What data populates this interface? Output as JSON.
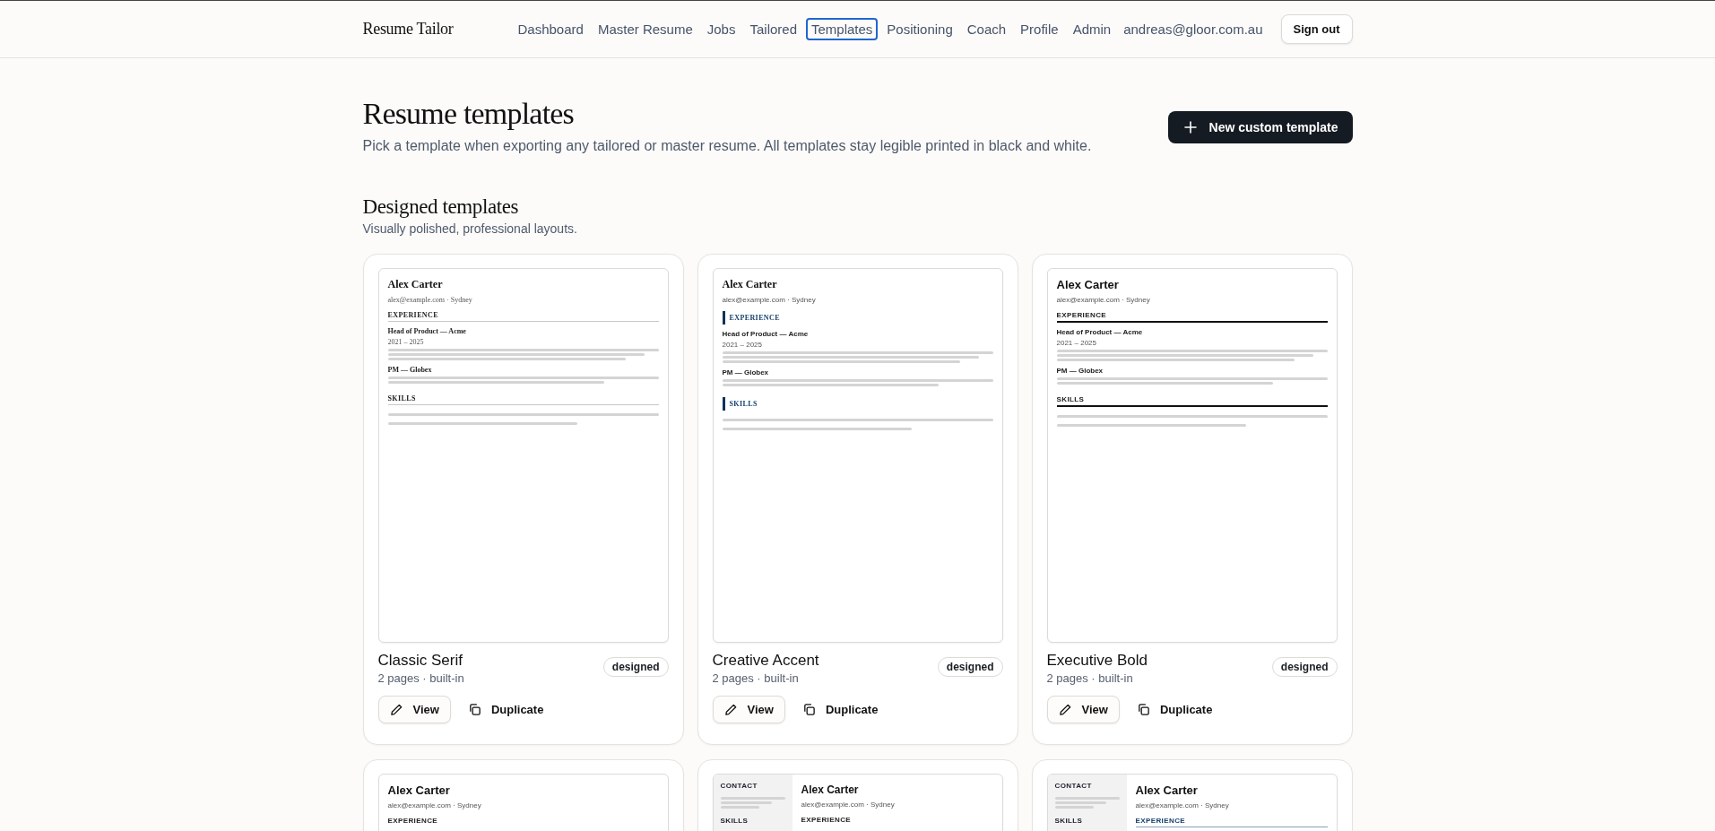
{
  "header": {
    "brand": "Resume Tailor",
    "nav": [
      {
        "label": "Dashboard",
        "selected": false
      },
      {
        "label": "Master Resume",
        "selected": false
      },
      {
        "label": "Jobs",
        "selected": false
      },
      {
        "label": "Tailored",
        "selected": false
      },
      {
        "label": "Templates",
        "selected": true
      },
      {
        "label": "Positioning",
        "selected": false
      },
      {
        "label": "Coach",
        "selected": false
      },
      {
        "label": "Profile",
        "selected": false
      },
      {
        "label": "Admin",
        "selected": false
      }
    ],
    "user": "andreas@gloor.com.au",
    "sign_out": "Sign out"
  },
  "page": {
    "title": "Resume templates",
    "subtitle": "Pick a template when exporting any tailored or master resume. All templates stay legible printed in black and white.",
    "new_button": "New custom template"
  },
  "section": {
    "title": "Designed templates",
    "subtitle": "Visually polished, professional layouts."
  },
  "templates": [
    {
      "kind": "classic",
      "preview": {
        "name": "Alex Carter",
        "contact": "alex@example.com · Sydney",
        "sections": [
          {
            "heading": "EXPERIENCE",
            "entries": [
              {
                "title": "Head of Product — Acme",
                "dates": "2021 – 2025"
              },
              {
                "title": "PM — Globex"
              }
            ]
          },
          {
            "heading": "SKILLS"
          }
        ]
      },
      "name": "Classic Serif",
      "meta": "2 pages · built-in",
      "badge": "designed",
      "actions": [
        "View",
        "Duplicate"
      ]
    },
    {
      "kind": "accent",
      "preview": {
        "name": "Alex Carter",
        "contact": "alex@example.com · Sydney",
        "sections": [
          {
            "heading": "EXPERIENCE",
            "entries": [
              {
                "title": "Head of Product — Acme",
                "dates": "2021 – 2025"
              },
              {
                "title": "PM — Globex"
              }
            ]
          },
          {
            "heading": "SKILLS"
          }
        ]
      },
      "name": "Creative Accent",
      "meta": "2 pages · built-in",
      "badge": "designed",
      "actions": [
        "View",
        "Duplicate"
      ]
    },
    {
      "kind": "bold",
      "preview": {
        "name": "Alex Carter",
        "contact": "alex@example.com · Sydney",
        "sections": [
          {
            "heading": "EXPERIENCE",
            "entries": [
              {
                "title": "Head of Product — Acme",
                "dates": "2021 – 2025"
              },
              {
                "title": "PM — Globex"
              }
            ]
          },
          {
            "heading": "SKILLS"
          }
        ]
      },
      "name": "Executive Bold",
      "meta": "2 pages · built-in",
      "badge": "designed",
      "actions": [
        "View",
        "Duplicate"
      ]
    },
    {
      "kind": "plain",
      "preview": {
        "name": "Alex Carter",
        "contact": "alex@example.com · Sydney",
        "sections": [
          {
            "heading": "EXPERIENCE"
          }
        ]
      }
    },
    {
      "kind": "sidebar",
      "preview": {
        "sidebar": [
          "CONTACT",
          "SKILLS"
        ],
        "name": "Alex Carter",
        "contact": "alex@example.com · Sydney",
        "sections": [
          {
            "heading": "EXPERIENCE"
          }
        ]
      }
    },
    {
      "kind": "sidebar-accent",
      "preview": {
        "sidebar": [
          "CONTACT",
          "SKILLS"
        ],
        "name": "Alex Carter",
        "contact": "alex@example.com · Sydney",
        "sections": [
          {
            "heading": "EXPERIENCE"
          }
        ]
      }
    }
  ]
}
